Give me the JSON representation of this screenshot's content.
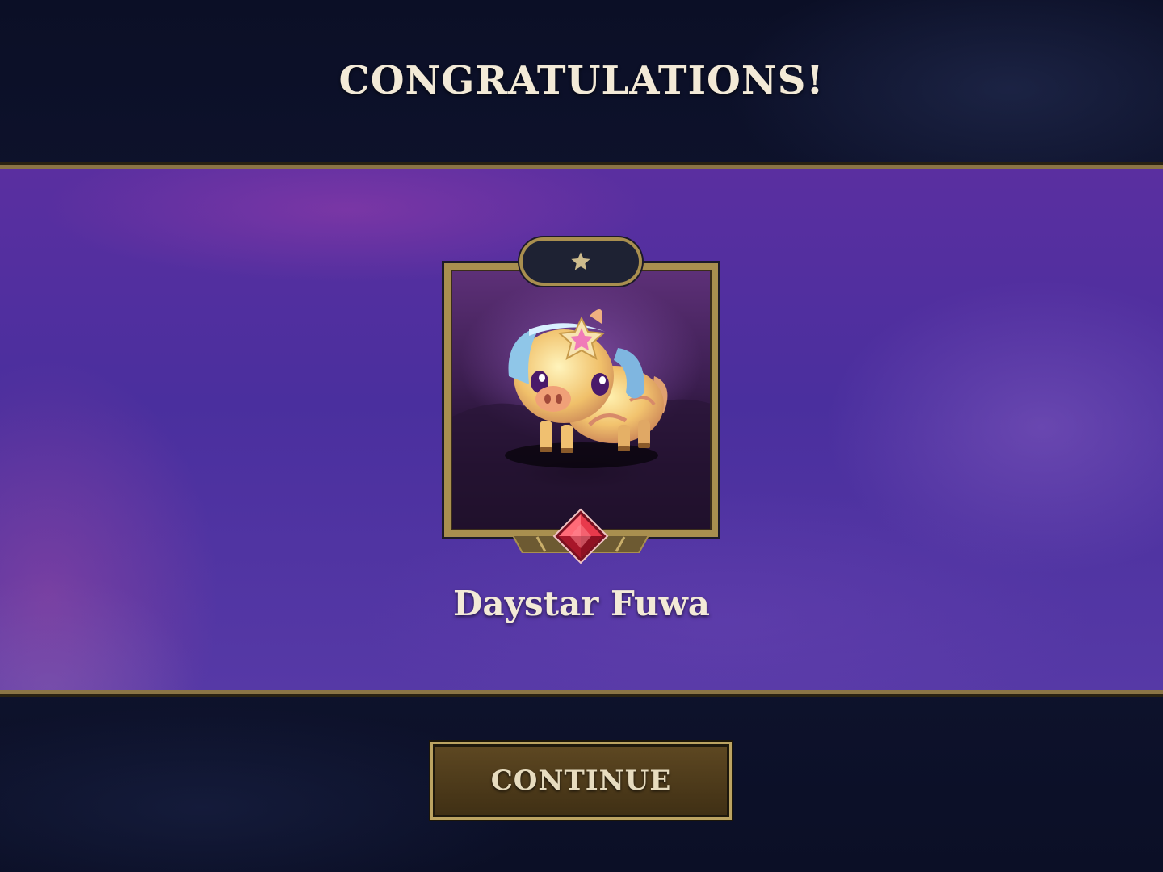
{
  "header": {
    "title": "CONGRATULATIONS!"
  },
  "reward": {
    "name": "Daystar Fuwa",
    "rarity_icon": "star-icon",
    "gem_icon": "red-gem-icon",
    "star_count": 1
  },
  "actions": {
    "continue_label": "CONTINUE"
  },
  "colors": {
    "banner": "#4a2f9e",
    "gold_border": "#a98f4f",
    "title_text": "#f3ead7",
    "button_bg": "#5e4822"
  }
}
